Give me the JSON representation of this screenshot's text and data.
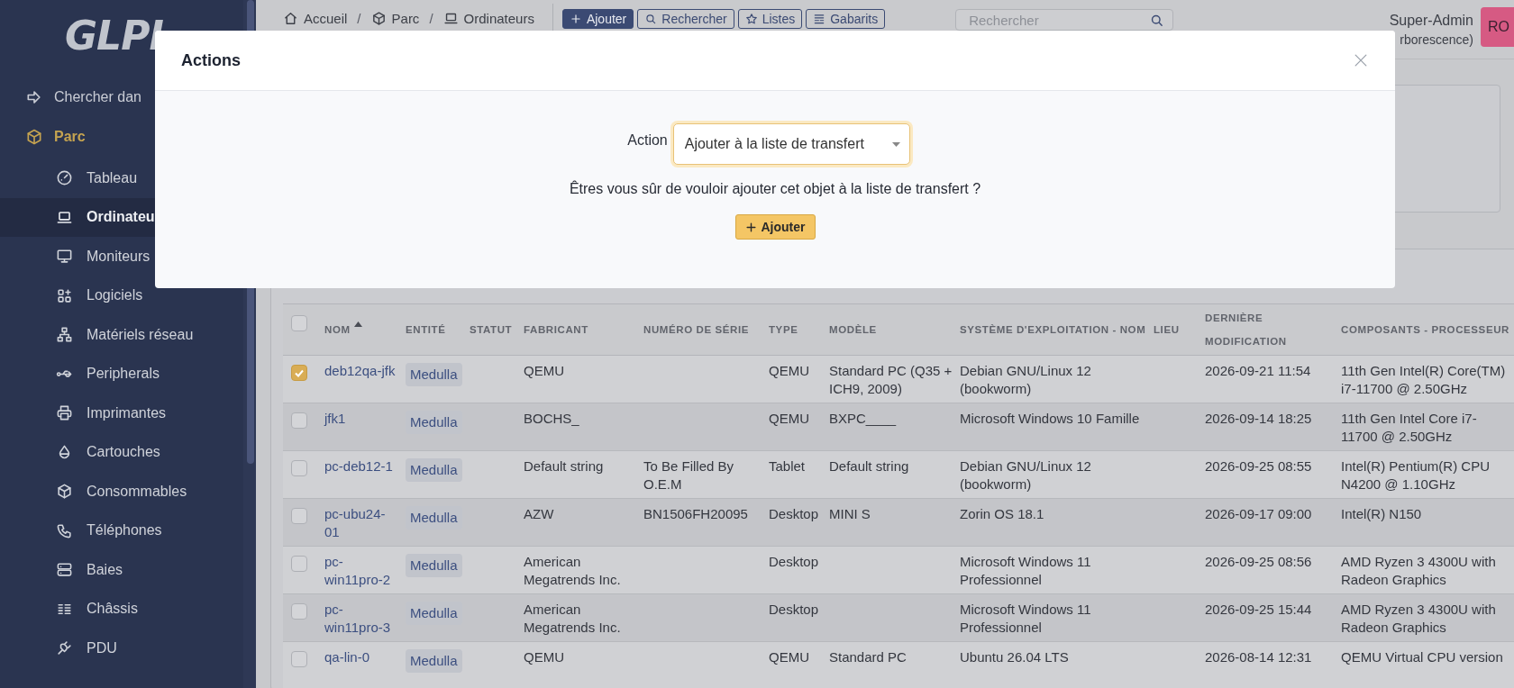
{
  "sidebar": {
    "logo": "GLPI",
    "search_item": "Chercher dan",
    "section": "Parc",
    "items": [
      {
        "label": "Tableau",
        "selected": false
      },
      {
        "label": "Ordinateu",
        "selected": true
      },
      {
        "label": "Moniteurs",
        "selected": false
      },
      {
        "label": "Logiciels",
        "selected": false
      },
      {
        "label": "Matériels réseau",
        "selected": false
      },
      {
        "label": "Peripherals",
        "selected": false
      },
      {
        "label": "Imprimantes",
        "selected": false
      },
      {
        "label": "Cartouches",
        "selected": false
      },
      {
        "label": "Consommables",
        "selected": false
      },
      {
        "label": "Téléphones",
        "selected": false
      },
      {
        "label": "Baies",
        "selected": false
      },
      {
        "label": "Châssis",
        "selected": false
      },
      {
        "label": "PDU",
        "selected": false
      }
    ]
  },
  "header": {
    "breadcrumb": [
      "Accueil",
      "Parc",
      "Ordinateurs"
    ],
    "separators": [
      "/",
      "/"
    ],
    "buttons": [
      {
        "label": "Ajouter",
        "kind": "primary"
      },
      {
        "label": "Rechercher",
        "kind": "outline"
      },
      {
        "label": "Listes",
        "kind": "outline"
      },
      {
        "label": "Gabarits",
        "kind": "outline"
      }
    ],
    "search": {
      "placeholder": "Rechercher"
    },
    "user": {
      "name": "Super-Admin",
      "profile": "rborescence)",
      "badge": "RO"
    }
  },
  "table": {
    "all_selected": false,
    "columns": [
      {
        "label": "NOM",
        "sorted": true
      },
      {
        "label": "ENTITÉ",
        "sorted": false
      },
      {
        "label": "STATUT",
        "sorted": false
      },
      {
        "label": "FABRICANT",
        "sorted": false
      },
      {
        "label": "NUMÉRO DE SÉRIE",
        "sorted": false
      },
      {
        "label": "TYPE",
        "sorted": false
      },
      {
        "label": "MODÈLE",
        "sorted": false
      },
      {
        "label": "SYSTÈME D'EXPLOITATION - NOM",
        "sorted": false
      },
      {
        "label": "LIEU",
        "sorted": false
      },
      {
        "label": "DERNIÈRE MODIFICATION",
        "sorted": false
      },
      {
        "label": "COMPOSANTS - PROCESSEUR",
        "sorted": false
      }
    ],
    "rows": [
      {
        "selected": true,
        "name": "deb12qa-jfk",
        "entity": "Medulla",
        "manufacturer": "QEMU",
        "type": "QEMU",
        "model": "Standard PC (Q35 + ICH9, 2009)",
        "os": "Debian GNU/Linux 12 (bookworm)",
        "modified": "2026-09-21 11:54",
        "cpu": "11th Gen Intel(R) Core(TM) i7-11700 @ 2.50GHz"
      },
      {
        "selected": false,
        "name": "jfk1",
        "entity": "Medulla",
        "manufacturer": "BOCHS_",
        "type": "QEMU",
        "model": "BXPC____",
        "os": "Microsoft Windows 10 Famille",
        "modified": "2026-09-14 18:25",
        "cpu": "11th Gen Intel Core i7-11700 @ 2.50GHz"
      },
      {
        "selected": false,
        "name": "pc-deb12-1",
        "entity": "Medulla",
        "manufacturer": "Default string",
        "serial": "To Be Filled By O.E.M",
        "type": "Tablet",
        "model": "Default string",
        "os": "Debian GNU/Linux 12 (bookworm)",
        "modified": "2026-09-25 08:55",
        "cpu": "Intel(R) Pentium(R) CPU N4200 @ 1.10GHz"
      },
      {
        "selected": false,
        "name": "pc-ubu24-01",
        "entity": "Medulla",
        "manufacturer": "AZW",
        "serial": "BN1506FH20095",
        "type": "Desktop",
        "model": "MINI S",
        "os": "Zorin OS 18.1",
        "modified": "2026-09-17 09:00",
        "cpu": "Intel(R) N150"
      },
      {
        "selected": false,
        "name": "pc-win11pro-2",
        "entity": "Medulla",
        "manufacturer": "American Megatrends Inc.",
        "type": "Desktop",
        "os": "Microsoft Windows 11 Professionnel",
        "modified": "2026-09-25 08:56",
        "cpu": "AMD Ryzen 3 4300U with Radeon Graphics"
      },
      {
        "selected": false,
        "name": "pc-win11pro-3",
        "entity": "Medulla",
        "manufacturer": "American Megatrends Inc.",
        "type": "Desktop",
        "os": "Microsoft Windows 11 Professionnel",
        "modified": "2026-09-25 15:44",
        "cpu": "AMD Ryzen 3 4300U with Radeon Graphics"
      },
      {
        "selected": false,
        "name": "qa-lin-0",
        "entity": "Medulla",
        "manufacturer": "QEMU",
        "type": "QEMU",
        "model": "Standard PC",
        "os": "Ubuntu 26.04 LTS",
        "modified": "2026-08-14 12:31",
        "cpu": "QEMU Virtual CPU version"
      }
    ]
  },
  "modal": {
    "title": "Actions",
    "action_label": "Action",
    "action_value": "Ajouter à la liste de transfert",
    "message": "Êtres vous sûr de vouloir ajouter cet objet à la liste de transfert ?",
    "button": "Ajouter"
  }
}
